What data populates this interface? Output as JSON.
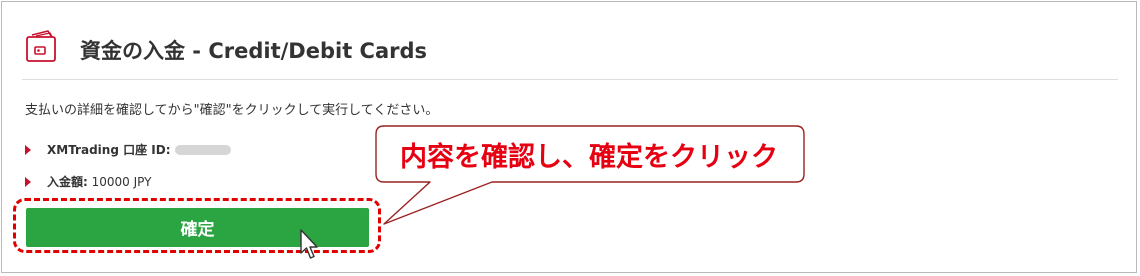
{
  "header": {
    "title": "資金の入金 - Credit/Debit Cards",
    "icon": "wallet-icon",
    "accent_color": "#c8102e"
  },
  "instruction": "支払いの詳細を確認してから\"確認\"をクリックして実行してください。",
  "details": {
    "account_label": "XMTrading 口座 ID:",
    "amount_label": "入金額:",
    "amount_value": "10000 JPY"
  },
  "confirm_button": {
    "label": "確定",
    "color": "#2aa541"
  },
  "annotation": {
    "callout_text": "内容を確認し、確定をクリック",
    "color": "#e60012"
  }
}
